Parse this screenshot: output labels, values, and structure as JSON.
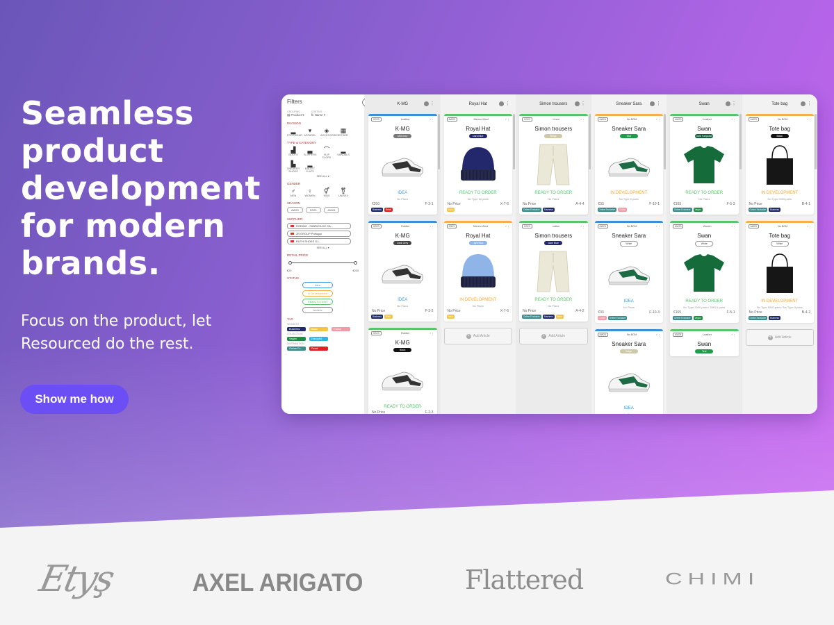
{
  "hero": {
    "headline": "Seamless product development for modern brands.",
    "subline": "Focus on the product, let Resourced do the rest.",
    "cta_label": "Show me how"
  },
  "filters": {
    "title": "Filters",
    "grouping_label": "GROUPING",
    "grouping_value": "Product",
    "sorting_label": "SORTING",
    "sorting_value": "Name",
    "division_label": "DIVISION",
    "division": [
      "FOOTWEAR",
      "APPAREL",
      "ACCESSORIES",
      "OTHER"
    ],
    "type_label": "TYPE & CATEGORY",
    "types": [
      "BOOTS",
      "SLIPPERS",
      "FLIP FLOPS",
      "SANDALS",
      "SNEAKER SHOES",
      "BALLET FLATS"
    ],
    "see_all": "SEE ALL",
    "gender_label": "GENDER",
    "genders": [
      "MEN",
      "WOMEN",
      "KIDS",
      "UNISEX"
    ],
    "season_label": "SEASON",
    "seasons": [
      "AW23",
      "SS23",
      "AW24"
    ],
    "supplier_label": "SUPPLIER",
    "suppliers": [
      "RODINO - FABRICA DE CA...",
      "2B GROUP Portugal",
      "RUTH SHOES S.L."
    ],
    "retail_label": "RETAIL PRICE",
    "retail_min": "€20",
    "retail_max": "€200",
    "status_label": "STATUS",
    "statuses": [
      "Idea",
      "In Development",
      "Ready To Order",
      "Archive"
    ],
    "tag_label": "TAG",
    "tag_groups": [
      {
        "label": "SEGMENT",
        "tags": [
          {
            "text": "Business",
            "color": "#1f2a6b"
          },
          {
            "text": "Basic",
            "color": "#f4c542"
          },
          {
            "text": "Cruise",
            "color": "#f29aa8"
          }
        ]
      },
      {
        "label": "COLLECTION",
        "tags": [
          {
            "text": "Vegan",
            "color": "#1e8c45"
          },
          {
            "text": "Disruptio",
            "color": "#2fb6e0"
          }
        ]
      },
      {
        "label": "DISTRIBUTION",
        "tags": [
          {
            "text": "Online Ex...",
            "color": "#3a8b8c"
          },
          {
            "text": "Retail",
            "color": "#e02020"
          }
        ]
      }
    ]
  },
  "columns": [
    {
      "title": "K-MG",
      "cards": [
        {
          "bar": "#3b8fd6",
          "season": "SS23",
          "material": "Leather",
          "name": "K-MG",
          "color_label": "Mid Grey",
          "color_bg": "#777",
          "img": "sneaker-dark",
          "status": "IDEA",
          "status_color": "#3b9ad9",
          "plan": "No Plans",
          "price": "€200",
          "code": "F-3-1",
          "chips": [
            {
              "t": "Business",
              "c": "#1f2a6b"
            },
            {
              "t": "Retail",
              "c": "#e02020"
            }
          ]
        },
        {
          "bar": "#3b8fd6",
          "season": "SS23",
          "material": "Rubber",
          "name": "K-MG",
          "color_label": "Dark Grey",
          "color_bg": "#444",
          "img": "sneaker-dark",
          "status": "IDEA",
          "status_color": "#3b9ad9",
          "plan": "No Plans",
          "price": "No Price",
          "code": "F-3-2",
          "chips": [
            {
              "t": "Business",
              "c": "#1f2a6b"
            },
            {
              "t": "Basic",
              "c": "#f4c542"
            }
          ]
        },
        {
          "bar": "#5ac46a",
          "season": "SS23",
          "material": "Rubber",
          "name": "K-MG",
          "color_label": "Black",
          "color_bg": "#111",
          "img": "sneaker-dark",
          "status": "READY TO ORDER",
          "status_color": "#5ac46a",
          "plan": "",
          "price": "No Price",
          "code": "F-2-3",
          "chips": []
        }
      ],
      "add": false
    },
    {
      "title": "Royal Hat",
      "cards": [
        {
          "bar": "#5ac46a",
          "season": "AW23",
          "material": "Merino Wool",
          "name": "Royal Hat",
          "color_label": "Dark Blue",
          "color_bg": "#22286b",
          "img": "beanie",
          "status": "READY TO ORDER",
          "status_color": "#5ac46a",
          "plan": "No Type  60 pairs",
          "price": "No Price",
          "code": "X-7-6",
          "chips": [
            {
              "t": "Basic",
              "c": "#f4c542"
            }
          ]
        },
        {
          "bar": "#f5b04c",
          "season": "SS23",
          "material": "Merino Wool",
          "name": "Royal Hat",
          "color_label": "Light Blue",
          "color_bg": "#8fb5e8",
          "img": "beanie",
          "status": "IN DEVELOPMENT",
          "status_color": "#f5a742",
          "plan": "No Plans",
          "price": "No Price",
          "code": "X-7-6",
          "chips": [
            {
              "t": "Basic",
              "c": "#f4c542"
            }
          ]
        }
      ],
      "add": true
    },
    {
      "title": "Simon trousers",
      "cards": [
        {
          "bar": "#5ac46a",
          "season": "SS23",
          "material": "Linen",
          "name": "Simon trousers",
          "color_label": "Beige",
          "color_bg": "#cfc8a8",
          "img": "trousers",
          "status": "READY TO ORDER",
          "status_color": "#5ac46a",
          "plan": "No Plans",
          "price": "No Price",
          "code": "A-4-4",
          "chips": [
            {
              "t": "Online Exclusive",
              "c": "#3a8b8c"
            },
            {
              "t": "Business",
              "c": "#1f2a6b"
            }
          ]
        },
        {
          "bar": "#5ac46a",
          "season": "SS23",
          "material": "cotton",
          "name": "Simon trousers",
          "color_label": "Dark Blue",
          "color_bg": "#22286b",
          "img": "trousers",
          "status": "READY TO ORDER",
          "status_color": "#5ac46a",
          "plan": "No Plans",
          "price": "No Price",
          "code": "A-4-2",
          "chips": [
            {
              "t": "Online Exclusive",
              "c": "#3a8b8c"
            },
            {
              "t": "Business",
              "c": "#1f2a6b"
            },
            {
              "t": "Basic",
              "c": "#f4c542"
            }
          ]
        }
      ],
      "add": true
    },
    {
      "title": "Sneaker Sara",
      "cards": [
        {
          "bar": "#f5b04c",
          "season": "AW24",
          "material": "No BOM",
          "name": "Sneaker Sara",
          "color_label": "Teal",
          "color_bg": "#1e9c4a",
          "img": "sneaker-green",
          "status": "IN DEVELOPMENT",
          "status_color": "#f5a742",
          "plan": "No Type  0 pairs",
          "price": "€33",
          "code": "F-10-1",
          "chips": [
            {
              "t": "Online Exclusive",
              "c": "#3a8b8c"
            },
            {
              "t": "Cruise",
              "c": "#f29aa8"
            }
          ]
        },
        {
          "bar": "#3b8fd6",
          "season": "AW24",
          "material": "No BOM",
          "name": "Sneaker Sara",
          "color_label": "White",
          "color_bg": "#fff",
          "img": "sneaker-green",
          "status": "IDEA",
          "status_color": "#3b9ad9",
          "plan": "No Plans",
          "price": "€33",
          "code": "F-10-3",
          "chips": [
            {
              "t": "Cruise",
              "c": "#f29aa8"
            },
            {
              "t": "Online Exclusive",
              "c": "#3a8b8c"
            }
          ]
        },
        {
          "bar": "#3b8fd6",
          "season": "AW24",
          "material": "No BOM",
          "name": "Sneaker Sara",
          "color_label": "Beige",
          "color_bg": "#cfc8a8",
          "img": "sneaker-green",
          "status": "IDEA",
          "status_color": "#3b9ad9",
          "plan": "No Plans",
          "price": "€33",
          "code": "F-10-2",
          "chips": [
            {
              "t": "Cruise",
              "c": "#f29aa8"
            },
            {
              "t": "Online Exclusive",
              "c": "#3a8b8c"
            }
          ]
        }
      ],
      "add": true
    },
    {
      "title": "Swan",
      "cards": [
        {
          "bar": "#5ac46a",
          "season": "AW23",
          "material": "Leather",
          "name": "Swan",
          "color_label": "Dark Turquoise",
          "color_bg": "#135c3b",
          "img": "tshirt",
          "status": "READY TO ORDER",
          "status_color": "#5ac46a",
          "plan": "No Plans",
          "price": "€165",
          "code": "F-5-3",
          "chips": [
            {
              "t": "Online Exclusive",
              "c": "#3a8b8c"
            },
            {
              "t": "Vegan",
              "c": "#1e8c45"
            }
          ]
        },
        {
          "bar": "#5ac46a",
          "season": "AW23",
          "material": "Woven",
          "name": "Swan",
          "color_label": "White",
          "color_bg": "#fff",
          "img": "tshirt",
          "status": "READY TO ORDER",
          "status_color": "#5ac46a",
          "plan": "No Type  2000 pairs / SMS  6 pairs",
          "price": "€165",
          "code": "F-5-1",
          "chips": [
            {
              "t": "Online Exclusive",
              "c": "#3a8b8c"
            },
            {
              "t": "Vegan",
              "c": "#1e8c45"
            }
          ]
        },
        {
          "bar": "#5ac46a",
          "season": "AW24",
          "material": "Leather",
          "name": "Swan",
          "color_label": "Teal",
          "color_bg": "#1e9c4a",
          "img": "",
          "status": "",
          "status_color": "#5ac46a",
          "plan": "",
          "price": "",
          "code": "",
          "chips": []
        }
      ],
      "add": false
    },
    {
      "title": "Tote bag",
      "cards": [
        {
          "bar": "#f5b04c",
          "season": "AW23",
          "material": "No BOM",
          "name": "Tote bag",
          "color_label": "Black",
          "color_bg": "#111",
          "img": "tote",
          "status": "IN DEVELOPMENT",
          "status_color": "#f5a742",
          "plan": "No Type  5000 pairs",
          "price": "No Price",
          "code": "B-4-1",
          "chips": [
            {
              "t": "Online Exclusive",
              "c": "#3a8b8c"
            },
            {
              "t": "Business",
              "c": "#1f2a6b"
            }
          ]
        },
        {
          "bar": "#f5b04c",
          "season": "AW23",
          "material": "No BOM",
          "name": "Tote bag",
          "color_label": "White",
          "color_bg": "#fff",
          "img": "tote",
          "status": "IN DEVELOPMENT",
          "status_color": "#f5a742",
          "plan": "No Type  5000 pairs / No Type  0 pairs",
          "price": "No Price",
          "code": "B-4-2",
          "chips": [
            {
              "t": "Online Exclusive",
              "c": "#3a8b8c"
            },
            {
              "t": "Business",
              "c": "#1f2a6b"
            }
          ]
        }
      ],
      "add": true
    }
  ],
  "add_article_label": "Add Article",
  "logos": {
    "etudes": "Etudes",
    "axel": "AXEL ARIGATO",
    "flattered": "Flattered",
    "chimi": "CHIMI"
  }
}
